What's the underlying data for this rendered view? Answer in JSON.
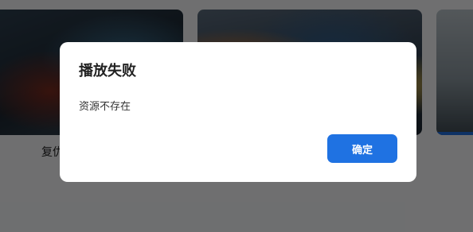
{
  "background": {
    "cards": [
      {
        "title": "复仇"
      },
      {
        "title": ""
      },
      {
        "title": ""
      }
    ],
    "accent_color": "#1f6fe0"
  },
  "dialog": {
    "title": "播放失败",
    "message": "资源不存在",
    "confirm_label": "确定",
    "confirm_color": "#1f72e2"
  }
}
